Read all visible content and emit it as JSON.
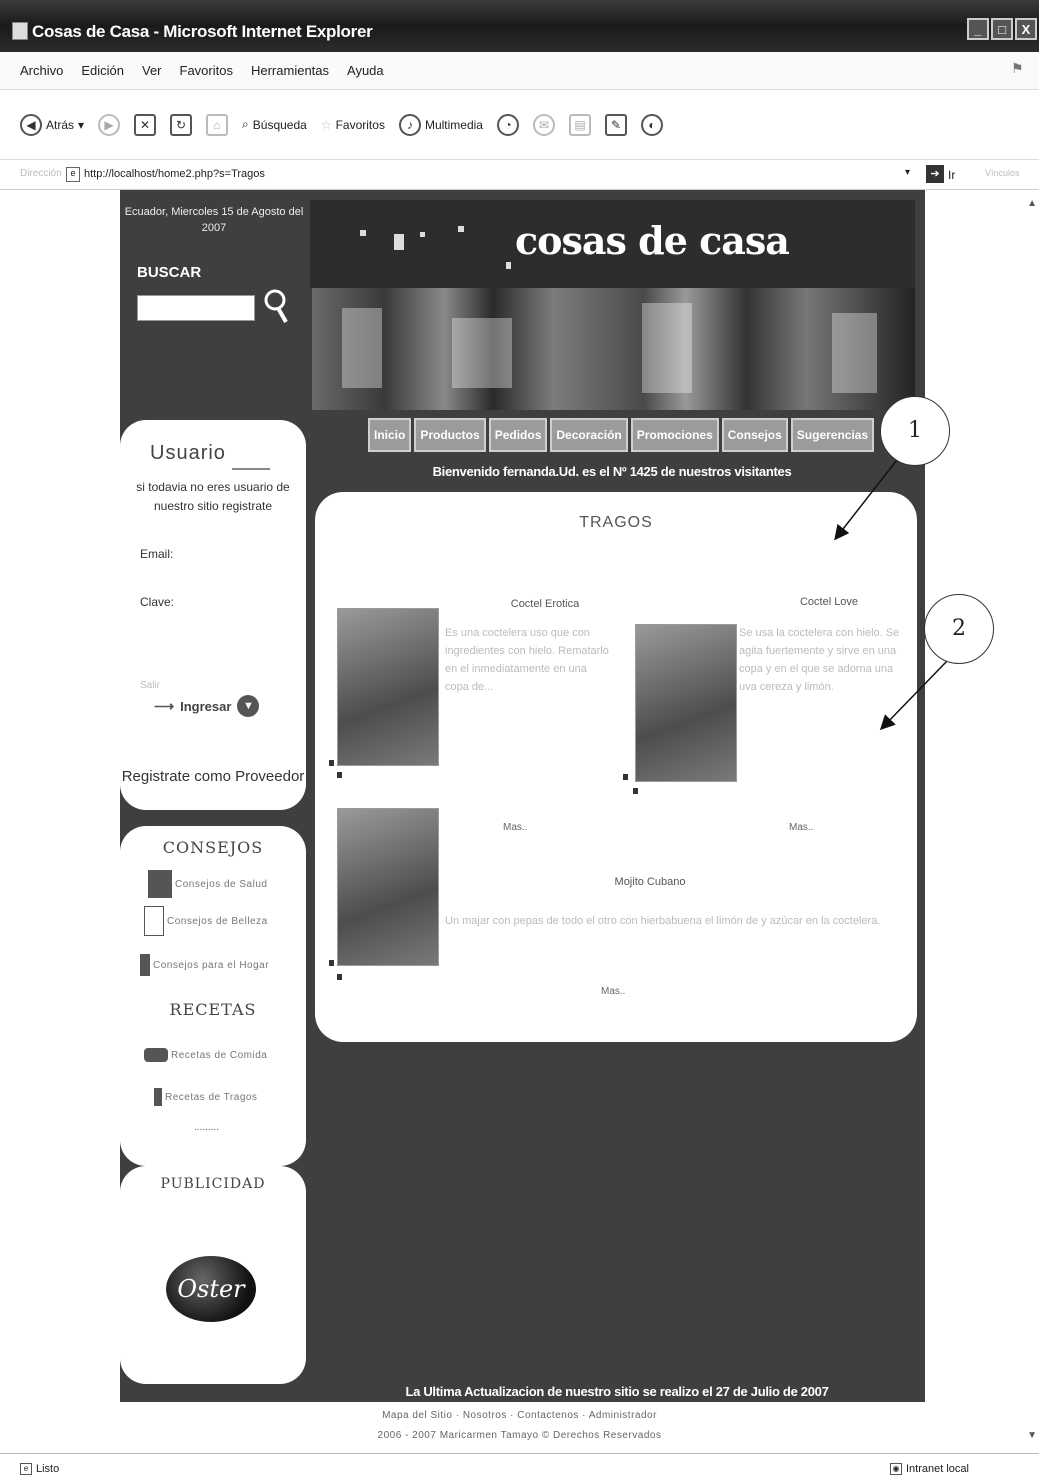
{
  "window": {
    "title": "Cosas de Casa - Microsoft Internet Explorer",
    "buttons": [
      "_",
      "□",
      "X"
    ]
  },
  "menu": [
    "Archivo",
    "Edición",
    "Ver",
    "Favoritos",
    "Herramientas",
    "Ayuda"
  ],
  "toolbar": {
    "back": "Atrás",
    "search": "Búsqueda",
    "favorites": "Favoritos",
    "multimedia": "Multimedia"
  },
  "address": {
    "url": "http://localhost/home2.php?s=Tragos",
    "go": "Ir"
  },
  "site": {
    "date": "Ecuador, Miercoles 15 de Agosto del 2007",
    "buscar": "BUSCAR",
    "banner_title": "cosas de casa",
    "nav": [
      "Inicio",
      "Productos",
      "Pedidos",
      "Decoración",
      "Promociones",
      "Consejos",
      "Sugerencias"
    ],
    "welcome": "Bienvenido fernanda.Ud. es el Nº 1425 de nuestros visitantes",
    "user": {
      "title": "Usuario",
      "subtitle": "si todavia no eres usuario de nuestro sitio registrate",
      "email_label": "Email:",
      "clave_label": "Clave:",
      "ingresar": "Ingresar",
      "registrate_proveedor": "Registrate como Proveedor"
    },
    "consejos": {
      "title": "CONSEJOS",
      "items": [
        "Consejos de Salud",
        "Consejos de Belleza",
        "Consejos para el Hogar"
      ]
    },
    "recetas": {
      "title": "RECETAS",
      "items": [
        "Recetas de Comida",
        "Recetas de Tragos"
      ],
      "dots": "........."
    },
    "publicidad": {
      "title": "PUBLICIDAD",
      "logo": "Oster"
    },
    "content": {
      "title": "TRAGOS",
      "products": [
        {
          "name": "Coctel Erotica",
          "desc": "Es una coctelera uso que con ingredientes con hielo. Rematarlo en el inmediatamente en una copa de...",
          "more": "Mas.."
        },
        {
          "name": "Coctel Love",
          "desc": "Se usa la coctelera con hielo. Se agita fuertemente y sirve en una copa y en el que se adorna una uva cereza y limón.",
          "more": "Mas.."
        },
        {
          "name": "Mojito Cubano",
          "desc": "Un majar con pepas de todo el otro con hierbabuena el limón de y azúcar en la coctelera.",
          "more": "Mas.."
        }
      ]
    },
    "footer_update": "La Ultima Actualizacion de nuestro sitio se realizo el 27 de Julio de 2007",
    "footer_links": "Mapa del Sitio · Nosotros · Contactenos · Administrador",
    "footer_copy": "2006 - 2007 Maricarmen Tamayo © Derechos Reservados"
  },
  "annotations": [
    "1",
    "2"
  ],
  "status": {
    "left": "Listo",
    "right": "Intranet local"
  }
}
